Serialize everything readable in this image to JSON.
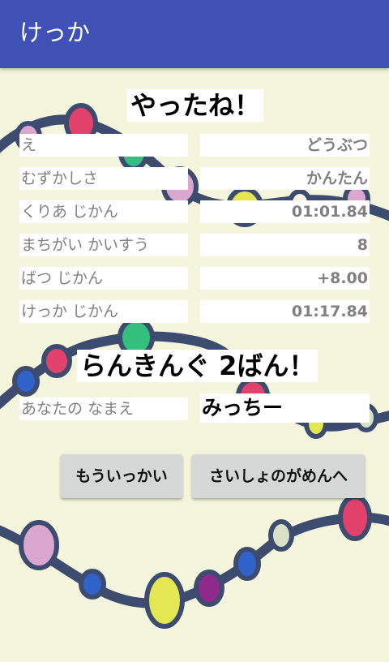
{
  "app_bar": {
    "title": "けっか"
  },
  "result": {
    "title": "やったね！",
    "rows": [
      {
        "label": "え",
        "value": "どうぶつ"
      },
      {
        "label": "むずかしさ",
        "value": "かんたん"
      },
      {
        "label": "くりあ じかん",
        "value": "01:01.84"
      },
      {
        "label": "まちがい かいすう",
        "value": "8"
      },
      {
        "label": "ばつ じかん",
        "value": "+8.00"
      },
      {
        "label": "けっか じかん",
        "value": "01:17.84"
      }
    ]
  },
  "ranking": {
    "title": "らんきんぐ 2ばん！",
    "name_label": "あなたの なまえ",
    "name_value": "みっちー"
  },
  "buttons": {
    "retry": "もういっかい",
    "to_start": "さいしょのがめんへ"
  },
  "colors": {
    "app_bar": "#3f51b5",
    "background": "#f3f5dc",
    "bead_line": "#3d4b6e"
  }
}
